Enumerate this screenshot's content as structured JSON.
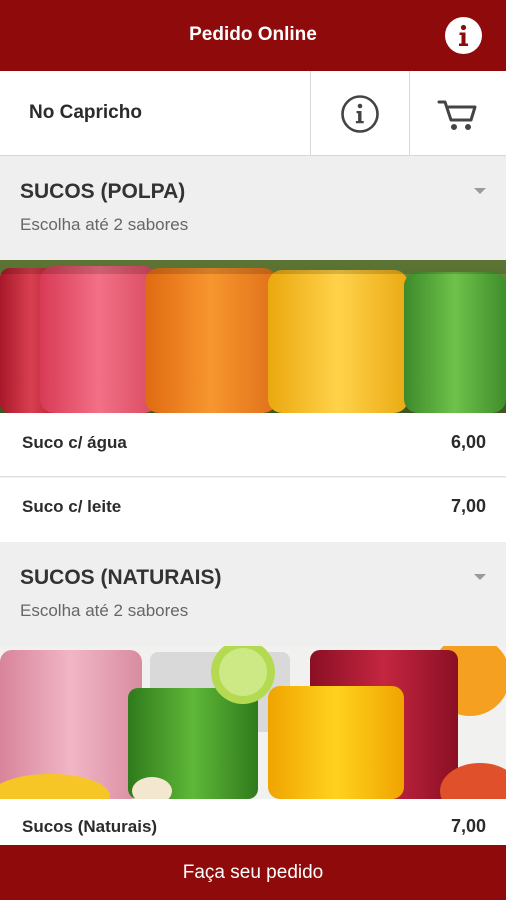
{
  "app": {
    "title": "Pedido Online",
    "store_name": "No Capricho"
  },
  "icons": {
    "info": "info-icon",
    "store_info": "info-circle-icon",
    "cart": "cart-icon",
    "expand": "triangle-down-icon"
  },
  "colors": {
    "brand": "#8f0a0a",
    "background": "#efefef"
  },
  "categories": [
    {
      "title": "SUCOS (POLPA)",
      "subtitle": "Escolha até 2 sabores",
      "items": [
        {
          "name": "Suco c/ água",
          "price": "6,00"
        },
        {
          "name": "Suco c/ leite",
          "price": "7,00"
        }
      ]
    },
    {
      "title": "SUCOS (NATURAIS)",
      "subtitle": "Escolha até 2 sabores",
      "items": [
        {
          "name": "Sucos (Naturais)",
          "price": "7,00"
        }
      ]
    }
  ],
  "footer": {
    "order_label": "Faça seu pedido"
  }
}
